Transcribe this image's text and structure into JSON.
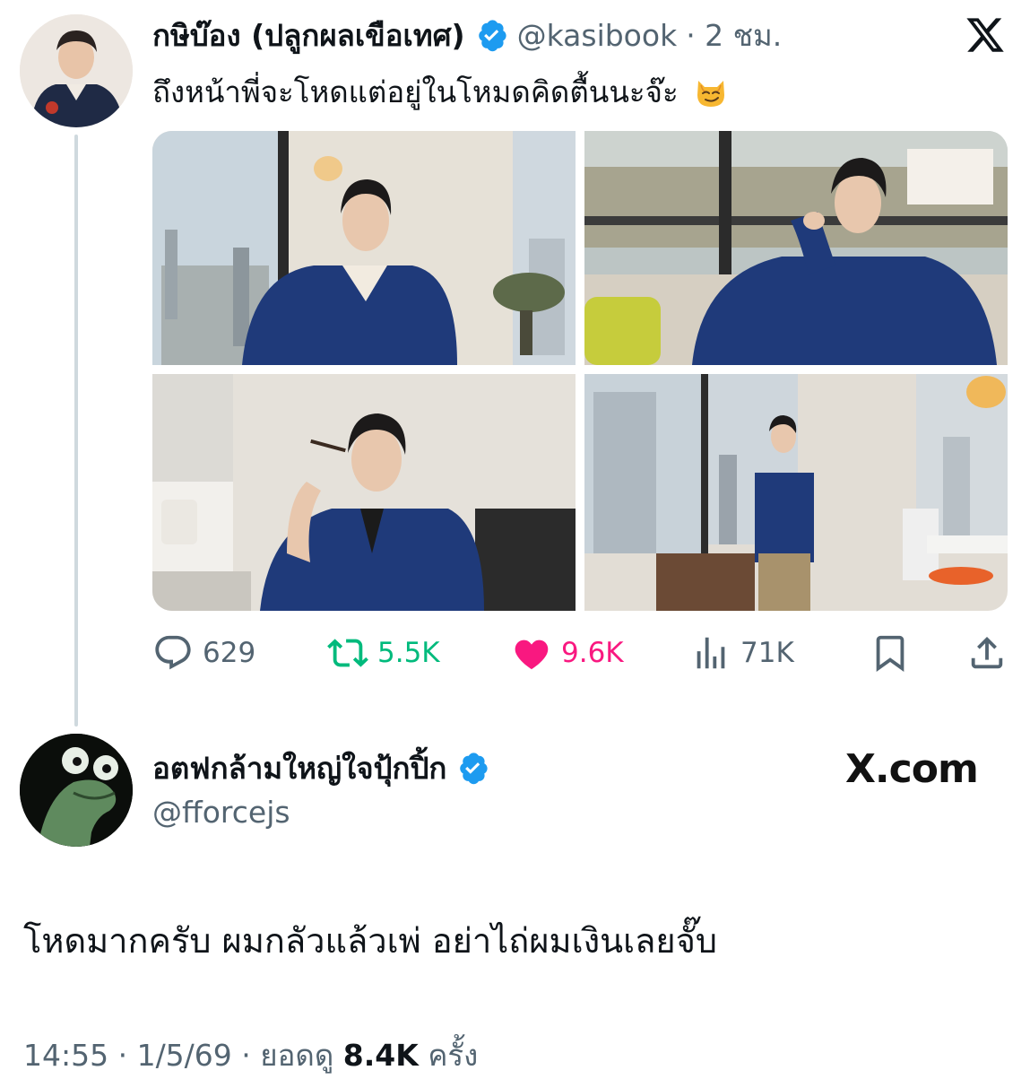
{
  "quoted_tweet": {
    "author_name": "กษิบ๊อง (ปลูกผลเขือเทศ)",
    "handle": "@kasibook",
    "time": "· 2 ชม.",
    "text": "ถึงหน้าพี่จะโหดแต่อยู่ในโหมดคิดตื้นนะจ๊ะ",
    "emoji": "smirking-cat-face-icon",
    "photos": [
      "photo-man-seated-by-window-with-lamp",
      "photo-man-leaning-chin-on-hand-by-window",
      "photo-man-holding-sunglasses-to-mouth",
      "photo-man-standing-in-cafe-full-length"
    ],
    "stats": {
      "replies": "629",
      "reposts": "5.5K",
      "likes": "9.6K",
      "views": "71K"
    }
  },
  "reply_tweet": {
    "author_name": "อตฟกล้ามใหญ่ใจปุ้กปิ้ก",
    "handle": "@fforcejs",
    "text": "โหดมากครับ ผมกลัวแล้วเพ่ อย่าไถ่ผมเงินเลยจั๊บ",
    "timestamp": "14:55 · 1/5/69 · ยอดดู",
    "views": "8.4K",
    "views_suffix": "ครั้ง"
  },
  "branding": {
    "watermark": "X.com"
  },
  "colors": {
    "verified_blue": "#1d9bf0",
    "repost_green": "#00ba7c",
    "like_pink": "#f91880",
    "secondary_text": "#536471",
    "primary_text": "#0f1419"
  }
}
